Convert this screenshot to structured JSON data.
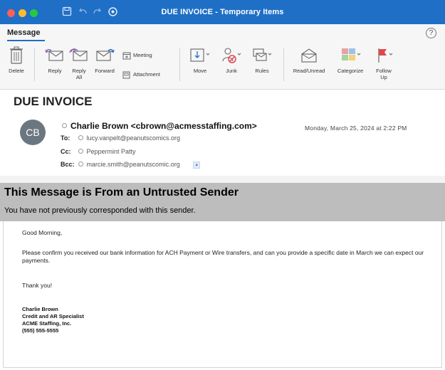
{
  "window": {
    "title": "DUE INVOICE - Temporary Items",
    "icons": [
      "save-icon",
      "undo-icon",
      "redo-icon",
      "sync-icon"
    ]
  },
  "tabs": {
    "active": "Message",
    "help_glyph": "?"
  },
  "ribbon": {
    "delete": "Delete",
    "reply": "Reply",
    "reply_all_line1": "Reply",
    "reply_all_line2": "All",
    "forward": "Forward",
    "meeting": "Meeting",
    "attachment": "Attachment",
    "move": "Move",
    "junk": "Junk",
    "rules": "Rules",
    "read_unread": "Read/Unread",
    "categorize": "Categorize",
    "follow_up_line1": "Follow",
    "follow_up_line2": "Up"
  },
  "message": {
    "subject": "DUE INVOICE",
    "avatar_initials": "CB",
    "from": "Charlie Brown <cbrown@acmesstaffing.com>",
    "date": "Monday, March 25, 2024 at 2:22 PM",
    "to_label": "To:",
    "to": "lucy.vanpelt@peanutscomics.org",
    "cc_label": "Cc:",
    "cc": "Peppermint Patty",
    "bcc_label": "Bcc:",
    "bcc": "marcie.smith@peanutscomic.org"
  },
  "banner": {
    "title": "This Message is From an Untrusted Sender",
    "text": "You have not previously corresponded with this sender."
  },
  "body": {
    "greeting": "Good Morning,",
    "paragraph": "Please confirm you received our bank information for ACH Payment or Wire transfers, and can you provide a specific date in March we can expect our payments.",
    "thanks": "Thank you!",
    "signature": [
      "Charlie Brown",
      "Credit and AR Specialist",
      "ACME Staffing, Inc.",
      "(555) 555-5555"
    ]
  },
  "colors": {
    "titlebar": "#1f6fc6",
    "banner": "#bdbdbd",
    "avatar": "#6b7780",
    "junk_icon": "#e0474c",
    "flag_icon": "#e0474c"
  }
}
